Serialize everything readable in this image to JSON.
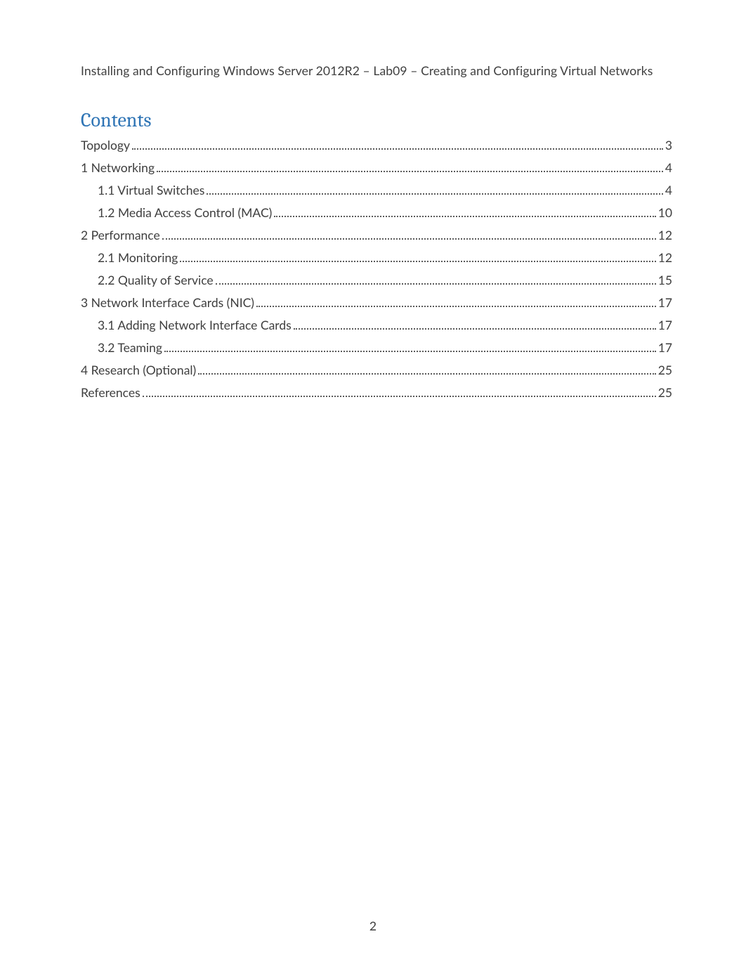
{
  "header": "Installing and Configuring Windows Server 2012R2 – Lab09 – Creating and Configuring Virtual Networks",
  "title": "Contents",
  "toc": [
    {
      "label": "Topology",
      "page": "3",
      "level": 1
    },
    {
      "label": "1 Networking",
      "page": "4",
      "level": 1
    },
    {
      "label": "1.1 Virtual Switches",
      "page": "4",
      "level": 2
    },
    {
      "label": "1.2 Media Access Control (MAC)",
      "page": "10",
      "level": 2
    },
    {
      "label": "2 Performance",
      "page": "12",
      "level": 1
    },
    {
      "label": "2.1 Monitoring",
      "page": "12",
      "level": 2
    },
    {
      "label": "2.2 Quality of Service",
      "page": "15",
      "level": 2
    },
    {
      "label": "3 Network Interface Cards (NIC)",
      "page": "17",
      "level": 1
    },
    {
      "label": "3.1 Adding Network Interface Cards",
      "page": "17",
      "level": 2
    },
    {
      "label": "3.2 Teaming",
      "page": "17",
      "level": 2
    },
    {
      "label": "4 Research (Optional)",
      "page": "25",
      "level": 1
    },
    {
      "label": "References",
      "page": "25",
      "level": 1
    }
  ],
  "page_number": "2"
}
